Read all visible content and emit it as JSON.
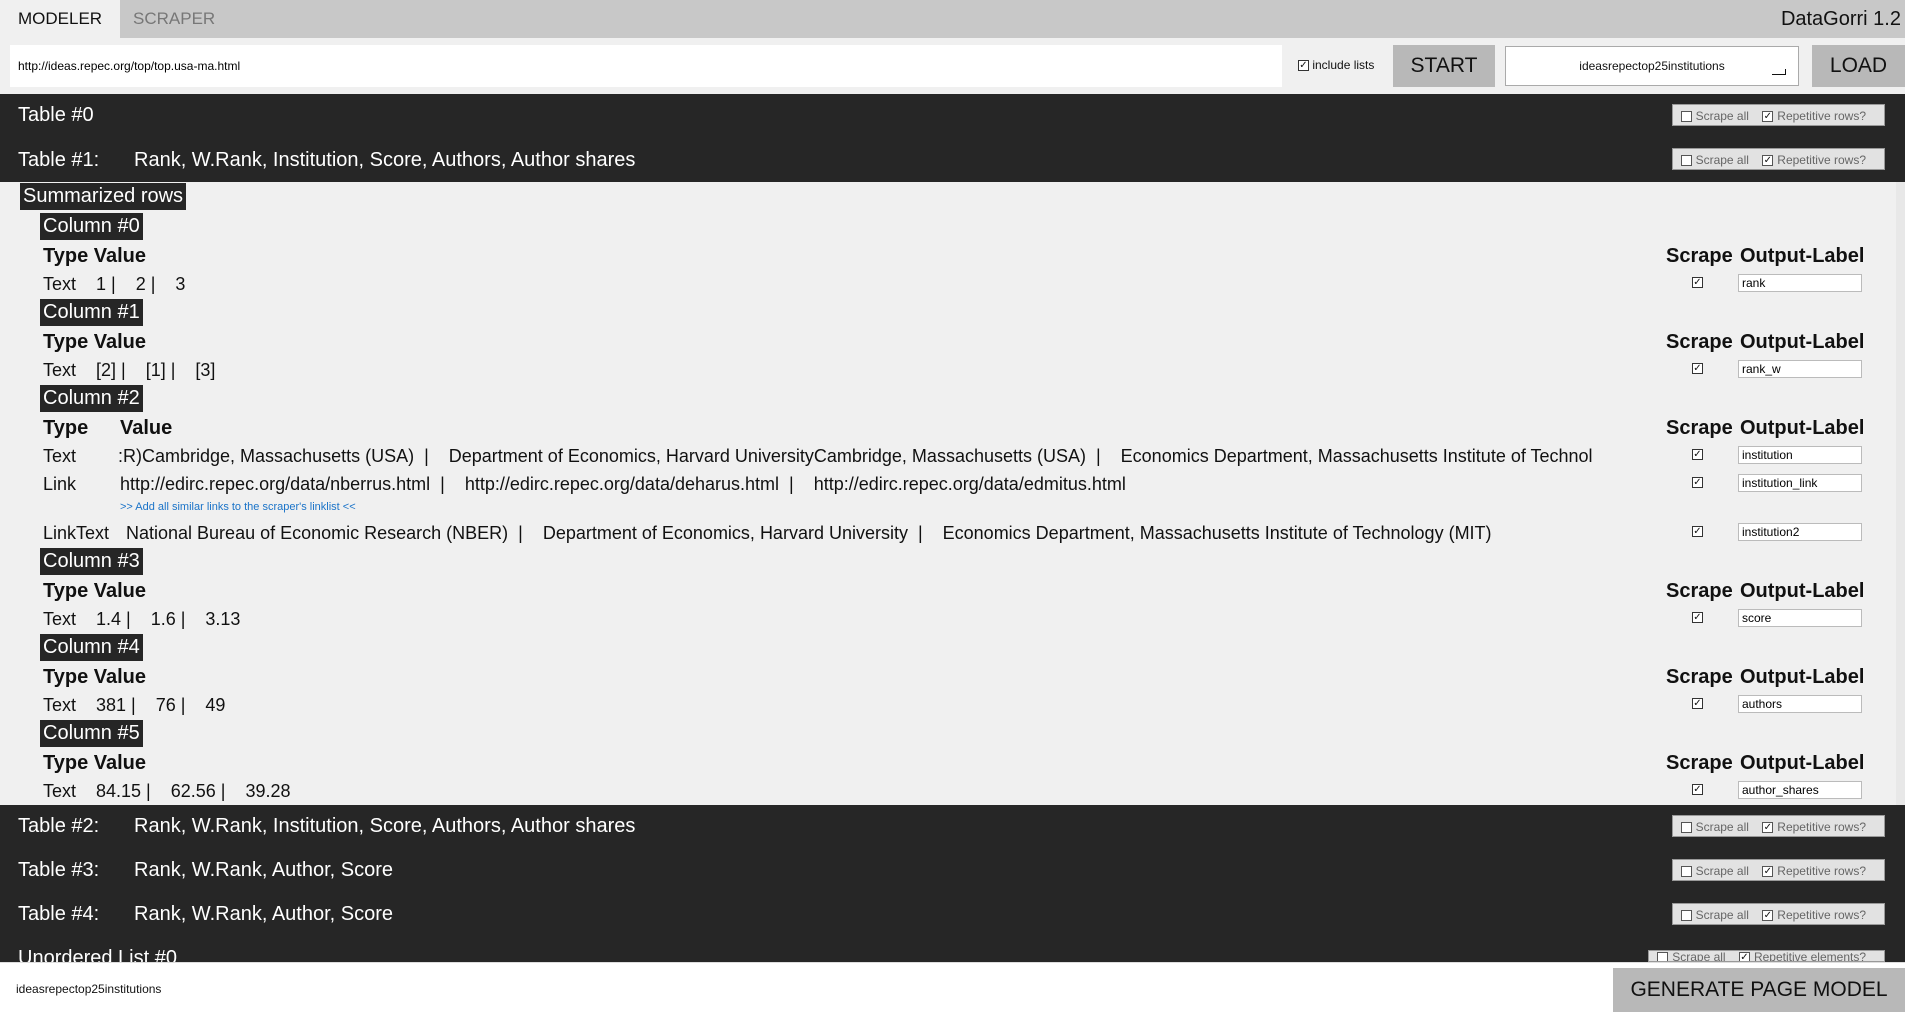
{
  "tabs": [
    "MODELER",
    "SCRAPER"
  ],
  "app_title": "DataGorri 1.2",
  "url_value": "http://ideas.repec.org/top/top.usa-ma.html",
  "include_lists": {
    "label": "include lists",
    "checked": true
  },
  "start_label": "START",
  "model_select": "ideasrepectop25institutions",
  "load_label": "LOAD",
  "opts": {
    "scrape_all": "Scrape all",
    "repetitive_rows": "Repetitive rows?",
    "repetitive_elements": "Repetitive elements?"
  },
  "tables": [
    {
      "title": "Table #0",
      "columns": ""
    },
    {
      "title": "Table #1:",
      "columns": "Rank, W.Rank, Institution, Score, Authors, Author shares"
    },
    {
      "title": "Table #2:",
      "columns": "Rank, W.Rank, Institution, Score, Authors, Author shares"
    },
    {
      "title": "Table #3:",
      "columns": "Rank, W.Rank, Author, Score"
    },
    {
      "title": "Table #4:",
      "columns": "Rank, W.Rank, Author, Score"
    },
    {
      "title": "Unordered List #0",
      "columns": ""
    }
  ],
  "summarized_rows": "Summarized rows",
  "headers": {
    "type": "Type",
    "value": "Value",
    "type_value": "Type Value",
    "scrape": "Scrape",
    "output_label": "Output-Label"
  },
  "columns": [
    {
      "label": "Column #0",
      "rows": [
        {
          "type": "Text",
          "value": "1 |    2 |    3",
          "output": "rank"
        }
      ]
    },
    {
      "label": "Column #1",
      "rows": [
        {
          "type": "Text",
          "value": "[2] |    [1] |    [3]",
          "output": "rank_w"
        }
      ]
    },
    {
      "label": "Column #2",
      "rows": [
        {
          "type": "Text",
          "value": ":R)Cambridge, Massachusetts (USA)  |    Department of Economics, Harvard UniversityCambridge, Massachusetts (USA)  |    Economics Department, Massachusetts Institute of Technol",
          "output": "institution"
        },
        {
          "type": "Link",
          "value": "http://edirc.repec.org/data/nberrus.html  |    http://edirc.repec.org/data/deharus.html  |    http://edirc.repec.org/data/edmitus.html",
          "output": "institution_link"
        },
        {
          "type": "LinkText",
          "value": "National Bureau of Economic Research (NBER)  |    Department of Economics, Harvard University  |    Economics Department, Massachusetts Institute of Technology (MIT)",
          "output": "institution2"
        }
      ],
      "add_link": ">> Add all similar links to the scraper's linklist <<"
    },
    {
      "label": "Column #3",
      "rows": [
        {
          "type": "Text",
          "value": "1.4 |    1.6 |    3.13",
          "output": "score"
        }
      ]
    },
    {
      "label": "Column #4",
      "rows": [
        {
          "type": "Text",
          "value": "381 |    76 |    49",
          "output": "authors"
        }
      ]
    },
    {
      "label": "Column #5",
      "rows": [
        {
          "type": "Text",
          "value": "84.15 |    62.56 |    39.28",
          "output": "author_shares"
        }
      ]
    }
  ],
  "model_name": "ideasrepectop25institutions",
  "generate_label": "GENERATE PAGE MODEL"
}
